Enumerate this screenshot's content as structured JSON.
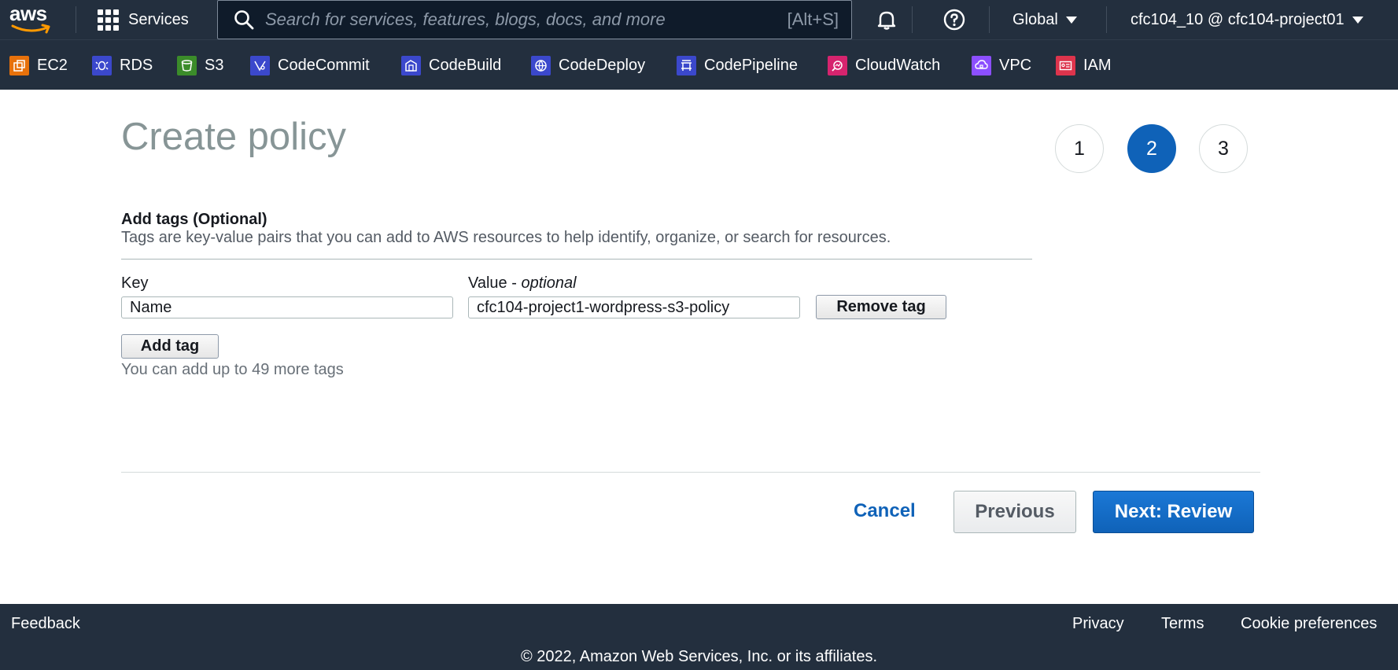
{
  "topnav": {
    "logo_text": "aws",
    "services_label": "Services",
    "search_placeholder": "Search for services, features, blogs, docs, and more",
    "search_shortcut": "[Alt+S]",
    "region": "Global",
    "account": "cfc104_10 @ cfc104-project01"
  },
  "favorites": [
    {
      "label": "EC2",
      "color": "#e7710b",
      "icon": "ec2-icon"
    },
    {
      "label": "RDS",
      "color": "#3b48cc",
      "icon": "rds-icon"
    },
    {
      "label": "S3",
      "color": "#3b8c2a",
      "icon": "s3-icon"
    },
    {
      "label": "CodeCommit",
      "color": "#3b48cc",
      "icon": "codecommit-icon"
    },
    {
      "label": "CodeBuild",
      "color": "#3b48cc",
      "icon": "codebuild-icon"
    },
    {
      "label": "CodeDeploy",
      "color": "#3b48cc",
      "icon": "codedeploy-icon"
    },
    {
      "label": "CodePipeline",
      "color": "#3b48cc",
      "icon": "codepipeline-icon"
    },
    {
      "label": "CloudWatch",
      "color": "#d6246e",
      "icon": "cloudwatch-icon"
    },
    {
      "label": "VPC",
      "color": "#8c4fff",
      "icon": "vpc-icon"
    },
    {
      "label": "IAM",
      "color": "#dd344c",
      "icon": "iam-icon"
    }
  ],
  "main": {
    "title": "Create policy",
    "steps": [
      "1",
      "2",
      "3"
    ],
    "active_step": "2",
    "section_title": "Add tags (Optional)",
    "section_desc": "Tags are key-value pairs that you can add to AWS resources to help identify, organize, or search for resources.",
    "key_label": "Key",
    "value_label_prefix": "Value - ",
    "value_label_italic": "optional",
    "tags": [
      {
        "key": "Name",
        "value": "cfc104-project1-wordpress-s3-policy"
      }
    ],
    "remove_tag_label": "Remove tag",
    "add_tag_label": "Add tag",
    "remaining_hint": "You can add up to 49 more tags",
    "cancel_label": "Cancel",
    "previous_label": "Previous",
    "next_label": "Next: Review"
  },
  "footer": {
    "feedback": "Feedback",
    "privacy": "Privacy",
    "terms": "Terms",
    "cookie": "Cookie preferences",
    "copyright": "© 2022, Amazon Web Services, Inc. or its affiliates."
  },
  "colors": {
    "nav_bg": "#232f3e",
    "primary": "#0f62b8",
    "title_gray": "#879596"
  }
}
